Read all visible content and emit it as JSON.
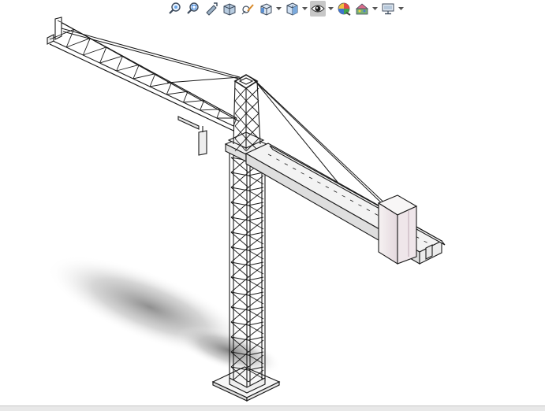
{
  "toolbar": {
    "buttons": [
      {
        "name": "zoom-to-fit-icon"
      },
      {
        "name": "zoom-to-area-icon"
      },
      {
        "name": "previous-view-icon"
      },
      {
        "name": "section-view-icon"
      },
      {
        "name": "dynamic-annotation-icon"
      },
      {
        "name": "view-orientation-icon",
        "dropdown": true
      },
      {
        "name": "display-style-icon",
        "dropdown": true
      },
      {
        "name": "hide-show-items-icon",
        "dropdown": true,
        "active": true
      },
      {
        "name": "edit-appearance-icon"
      },
      {
        "name": "apply-scene-icon",
        "dropdown": true
      },
      {
        "name": "view-settings-icon",
        "dropdown": true
      }
    ]
  },
  "scene": {
    "object": "tower-crane",
    "colors": {
      "steel": "#eeeeee",
      "outline": "#1a1a1a",
      "shadow": "#8a8a8a",
      "counterweight": "#f1ecec",
      "counterweight_edge": "#d9c9d2"
    }
  }
}
